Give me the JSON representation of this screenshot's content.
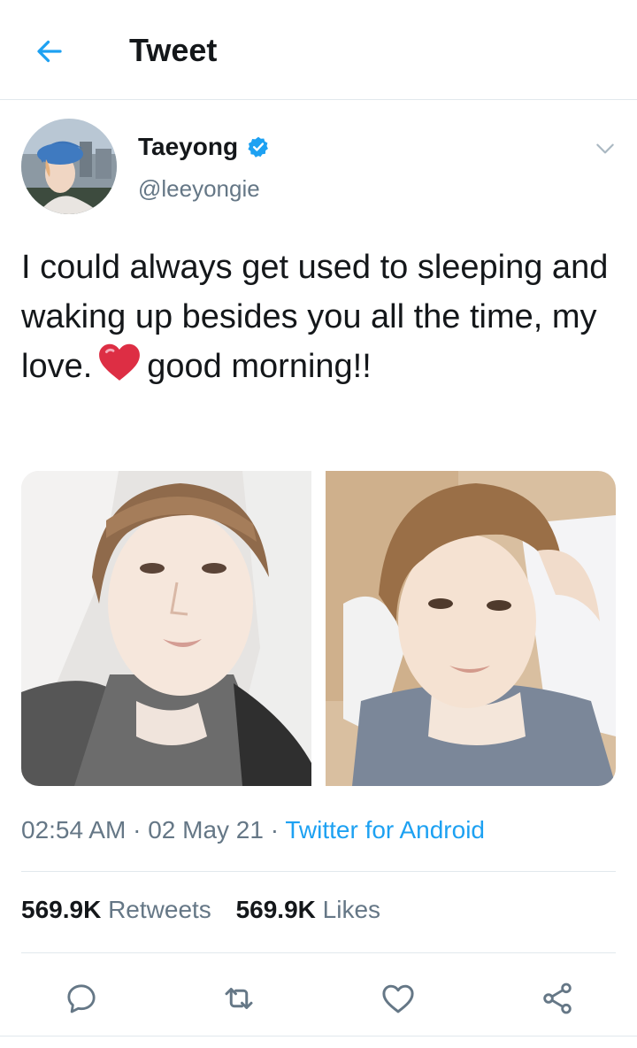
{
  "header": {
    "title": "Tweet",
    "back_icon": "arrow-left-icon"
  },
  "colors": {
    "accent": "#1da1f2",
    "secondary_text": "#657786",
    "heart": "#e0245e"
  },
  "tweet": {
    "display_name": "Taeyong",
    "verified": true,
    "handle": "@leeyongie",
    "text_part1": "I could always get used to sleeping and waking up besides you all the time,  my love.",
    "emoji": "❤️",
    "text_part2": "good morning!!",
    "time": "02:54 AM",
    "date": "02 May 21",
    "separator": "·",
    "source": "Twitter for Android",
    "retweets_count": "569.9K",
    "retweets_label": "Retweets",
    "likes_count": "569.9K",
    "likes_label": "Likes"
  },
  "actions": [
    "reply-icon",
    "retweet-icon",
    "like-icon",
    "share-icon"
  ]
}
